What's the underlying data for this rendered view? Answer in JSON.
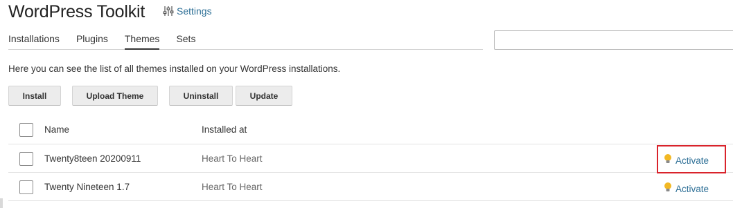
{
  "header": {
    "title": "WordPress Toolkit",
    "settings_label": "Settings",
    "settings_icon": "sliders-icon"
  },
  "tabs": [
    {
      "label": "Installations",
      "active": false
    },
    {
      "label": "Plugins",
      "active": false
    },
    {
      "label": "Themes",
      "active": true
    },
    {
      "label": "Sets",
      "active": false
    }
  ],
  "search": {
    "value": "",
    "placeholder": ""
  },
  "description": "Here you can see the list of all themes installed on your WordPress installations.",
  "toolbar": {
    "install_label": "Install",
    "upload_label": "Upload Theme",
    "uninstall_label": "Uninstall",
    "update_label": "Update"
  },
  "table": {
    "columns": [
      "Name",
      "Installed at"
    ],
    "rows": [
      {
        "name": "Twenty8teen 20200911",
        "installed_at": "Heart To Heart",
        "action": "Activate"
      },
      {
        "name": "Twenty Nineteen 1.7",
        "installed_at": "Heart To Heart",
        "action": "Activate"
      }
    ]
  },
  "colors": {
    "link": "#2d6f96",
    "highlight": "#d9232b",
    "bulb": "#f2b824"
  }
}
